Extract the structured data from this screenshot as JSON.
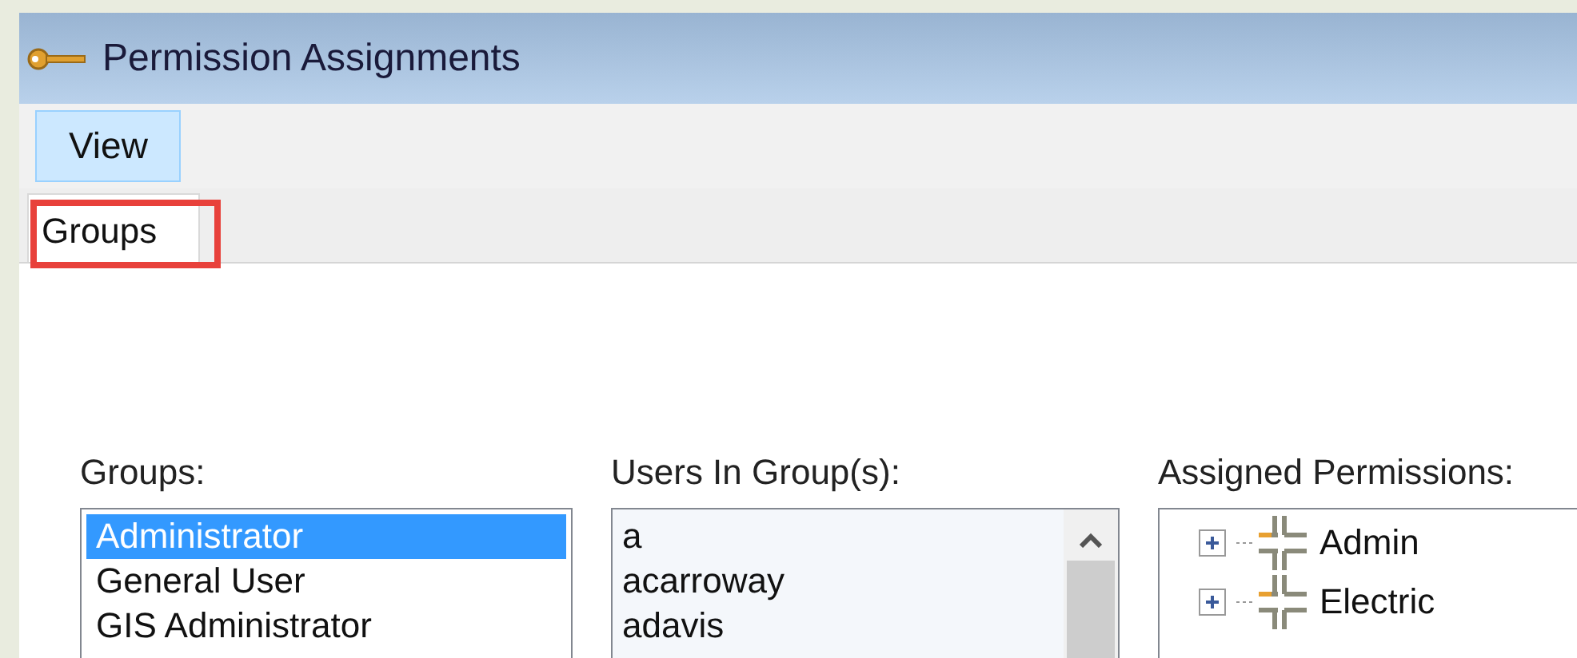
{
  "window": {
    "title": "Permission Assignments"
  },
  "toolbar": {
    "buttons": [
      {
        "label": "View",
        "selected": true
      }
    ]
  },
  "tabs": [
    {
      "label": "Groups",
      "selected": true,
      "highlighted": true
    }
  ],
  "groups_list": {
    "label": "Groups:",
    "items": [
      {
        "text": "Administrator",
        "selected": true
      },
      {
        "text": "General User",
        "selected": false
      },
      {
        "text": "GIS Administrator",
        "selected": false
      }
    ]
  },
  "users_list": {
    "label": "Users In Group(s):",
    "items": [
      "a",
      "acarroway",
      "adavis"
    ]
  },
  "permissions_tree": {
    "label": "Assigned Permissions:",
    "items": [
      {
        "text": "Admin",
        "expanded": false
      },
      {
        "text": "Electric",
        "expanded": false
      }
    ]
  }
}
